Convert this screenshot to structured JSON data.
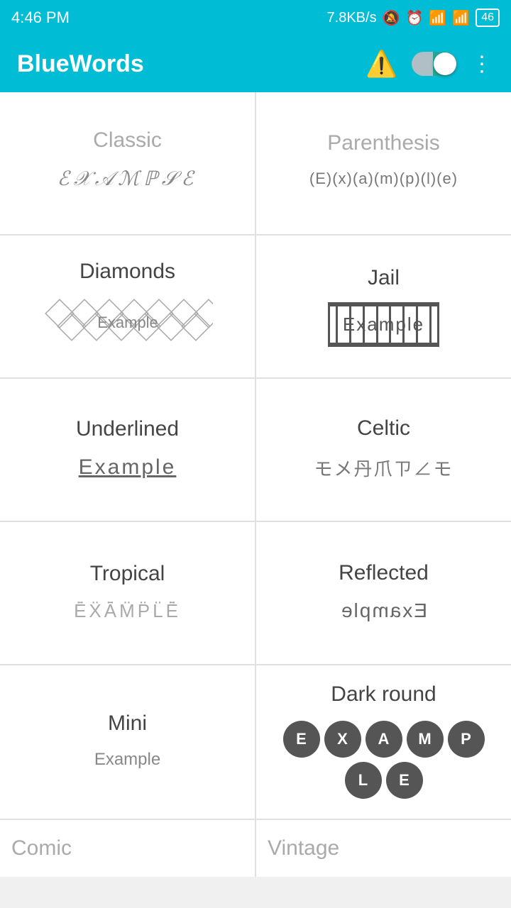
{
  "statusBar": {
    "time": "4:46 PM",
    "network": "7.8KB/s",
    "battery": "46"
  },
  "appBar": {
    "title": "BlueWords",
    "warningIcon": "⚠️",
    "moreIcon": "⋮"
  },
  "cards": [
    {
      "id": "classic",
      "title": "Classic",
      "example": "𝔼𝕏𝔸𝕄ℙ𝕃𝔼",
      "type": "classic",
      "partial": true
    },
    {
      "id": "parenthesis",
      "title": "Parenthesis",
      "example": "(E)(x)(a)(m)(p)(l)(e)",
      "type": "parenthesis",
      "partial": true
    },
    {
      "id": "diamonds",
      "title": "Diamonds",
      "example": "Example",
      "type": "diamonds"
    },
    {
      "id": "jail",
      "title": "Jail",
      "example": "Example",
      "type": "jail"
    },
    {
      "id": "underlined",
      "title": "Underlined",
      "example": "Example",
      "type": "underlined"
    },
    {
      "id": "celtic",
      "title": "Celtic",
      "example": "モメ丹爪ㄗ∠モ",
      "type": "celtic"
    },
    {
      "id": "tropical",
      "title": "Tropical",
      "example": "ĒXĀMPLĒ",
      "type": "tropical"
    },
    {
      "id": "reflected",
      "title": "Reflected",
      "example": "Ǝxɐɯdlə",
      "type": "reflected"
    },
    {
      "id": "mini",
      "title": "Mini",
      "example": "Example",
      "type": "mini"
    },
    {
      "id": "darkround",
      "title": "Dark round",
      "letters": [
        "E",
        "X",
        "A",
        "M",
        "P",
        "L",
        "E"
      ],
      "type": "darkround"
    },
    {
      "id": "comic",
      "title": "Comic",
      "type": "partial-bottom"
    },
    {
      "id": "vintage",
      "title": "Vintage",
      "type": "partial-bottom"
    }
  ]
}
